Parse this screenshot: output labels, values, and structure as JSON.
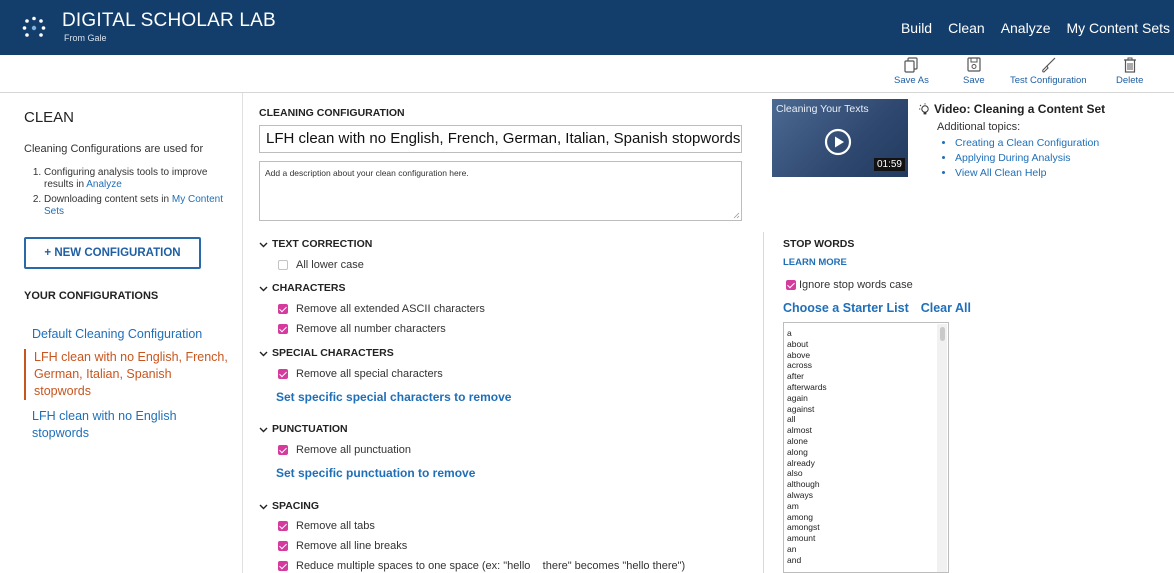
{
  "header": {
    "brand_title": "DIGITAL SCHOLAR LAB",
    "brand_sub": "From Gale",
    "nav": [
      "Build",
      "Clean",
      "Analyze",
      "My Content Sets"
    ],
    "bg_color": "#133e6b"
  },
  "toolbar": {
    "save_as": "Save As",
    "save": "Save",
    "test_config": "Test Configuration",
    "delete": "Delete"
  },
  "left": {
    "heading": "CLEAN",
    "description": "Cleaning Configurations are used for",
    "uses": [
      {
        "text": "Configuring analysis tools to improve results in ",
        "link": "Analyze"
      },
      {
        "text": "Downloading content sets in ",
        "link": "My Content Sets"
      }
    ],
    "new_button": "+ NEW CONFIGURATION",
    "your_configs": "YOUR CONFIGURATIONS",
    "configs": [
      "Default Cleaning Configuration",
      "LFH clean with no English, French, German, Italian, Spanish stopwords",
      "LFH clean with no English stopwords"
    ],
    "active_config_index": 1
  },
  "center": {
    "title": "CLEANING CONFIGURATION",
    "name_value": "LFH clean with no English, French, German, Italian, Spanish stopwords",
    "description_placeholder": "Add a description about your clean configuration here.",
    "groups": {
      "text_correction": {
        "label": "TEXT CORRECTION",
        "options": [
          {
            "label": "All lower case",
            "checked": false
          }
        ]
      },
      "characters": {
        "label": "CHARACTERS",
        "options": [
          {
            "label": "Remove all extended ASCII characters",
            "checked": true
          },
          {
            "label": "Remove all number characters",
            "checked": true
          }
        ]
      },
      "special": {
        "label": "SPECIAL CHARACTERS",
        "options": [
          {
            "label": "Remove all special characters",
            "checked": true
          }
        ],
        "link": "Set specific special characters to remove"
      },
      "punctuation": {
        "label": "PUNCTUATION",
        "options": [
          {
            "label": "Remove all punctuation",
            "checked": true
          }
        ],
        "link": "Set specific punctuation to remove"
      },
      "spacing": {
        "label": "SPACING",
        "options": [
          {
            "label": "Remove all tabs",
            "checked": true
          },
          {
            "label": "Remove all line breaks",
            "checked": true
          },
          {
            "label": "Reduce multiple spaces to one space (ex: \"hello    there\" becomes \"hello there\")",
            "checked": true
          }
        ]
      }
    }
  },
  "right": {
    "video_title": "Cleaning Your Texts",
    "video_duration": "01:59",
    "video_heading": "Video: Cleaning a Content Set",
    "additional": "Additional topics:",
    "topics": [
      "Creating a Clean Configuration",
      "Applying During Analysis",
      "View All Clean Help"
    ],
    "stop_words_title": "STOP WORDS",
    "learn_more": "LEARN MORE",
    "ignore_case": "Ignore stop words case",
    "choose_starter": "Choose a Starter List",
    "clear_all": "Clear All",
    "stop_words": [
      "a",
      "about",
      "above",
      "across",
      "after",
      "afterwards",
      "again",
      "against",
      "all",
      "almost",
      "alone",
      "along",
      "already",
      "also",
      "although",
      "always",
      "am",
      "among",
      "amongst",
      "amount",
      "an",
      "and"
    ]
  },
  "colors": {
    "accent": "#1f6fb8",
    "active": "#c8551e",
    "checkbox": "#d53a9d"
  }
}
